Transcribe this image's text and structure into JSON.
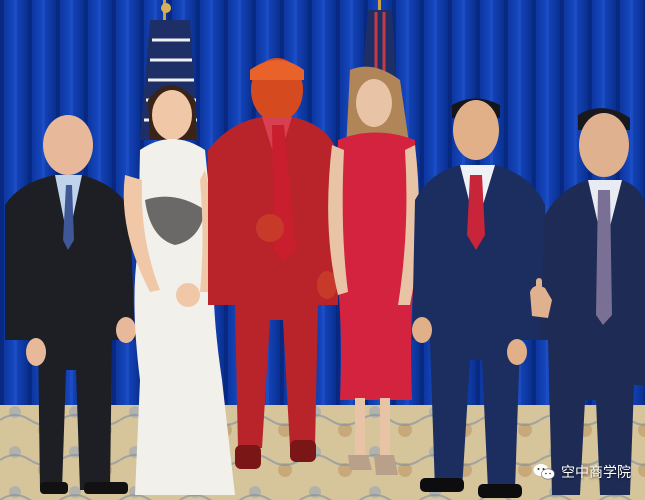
{
  "scene": {
    "description_colors": {
      "curtain": "#0c3ba8",
      "curtain_dark": "#072a82",
      "carpet": "#d8c8a0",
      "red_figure": "#c0262b",
      "red_dress": "#d5233f",
      "white_dress": "#f1efe9",
      "dark_suit": "#1d1f24",
      "navy_suit": "#1b2c5c"
    },
    "figures": [
      {
        "id": "man-left",
        "suit": "dark"
      },
      {
        "id": "woman-white-dress",
        "dress": "white"
      },
      {
        "id": "man-red",
        "suit": "red"
      },
      {
        "id": "woman-red-dress",
        "dress": "red"
      },
      {
        "id": "man-center-right",
        "suit": "navy"
      },
      {
        "id": "man-right",
        "suit": "navy"
      }
    ],
    "flags": 2
  },
  "watermark": {
    "text": "空中商学院",
    "icon": "wechat-icon"
  }
}
